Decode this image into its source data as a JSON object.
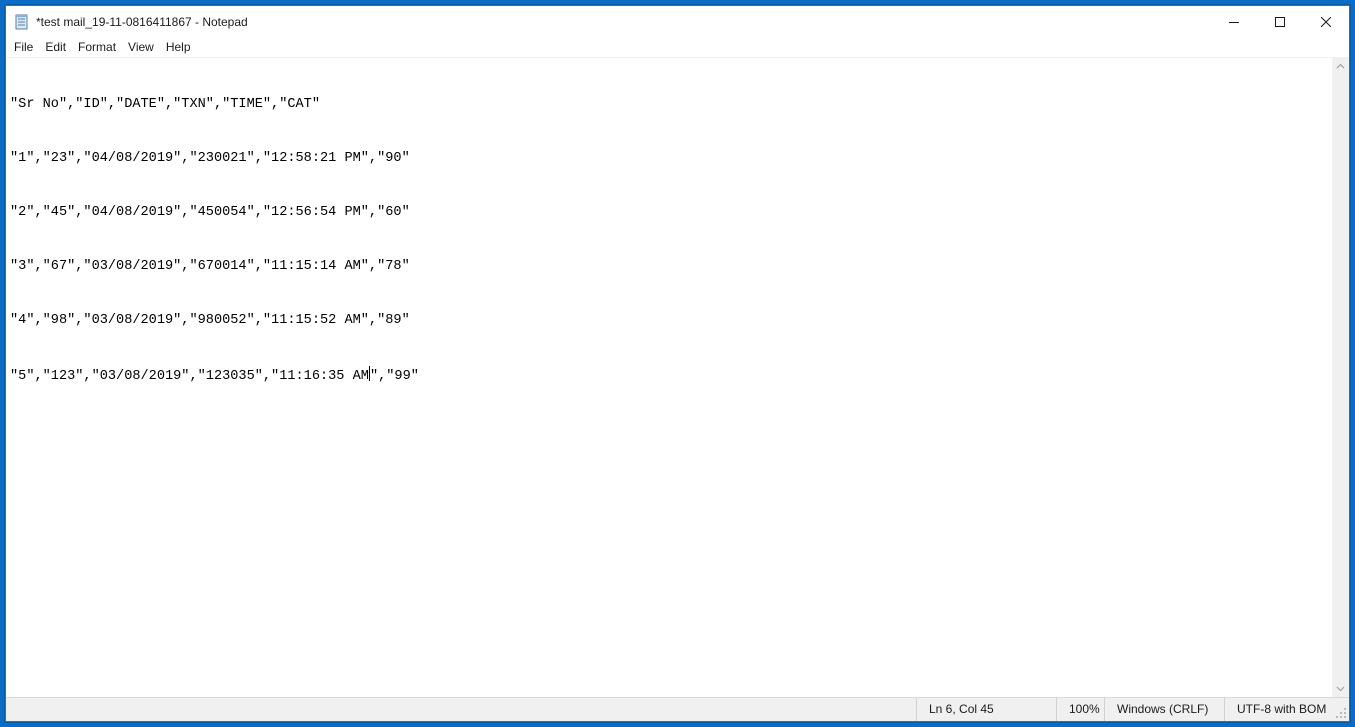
{
  "window": {
    "title": "*test mail_19-11-0816411867 - Notepad",
    "controls": {
      "minimize": "minimize-icon",
      "maximize": "maximize-icon",
      "close": "close-icon"
    }
  },
  "menu": [
    "File",
    "Edit",
    "Format",
    "View",
    "Help"
  ],
  "editor": {
    "lines": [
      "\"Sr No\",\"ID\",\"DATE\",\"TXN\",\"TIME\",\"CAT\"",
      "\"1\",\"23\",\"04/08/2019\",\"230021\",\"12:58:21 PM\",\"90\"",
      "\"2\",\"45\",\"04/08/2019\",\"450054\",\"12:56:54 PM\",\"60\"",
      "\"3\",\"67\",\"03/08/2019\",\"670014\",\"11:15:14 AM\",\"78\"",
      "\"4\",\"98\",\"03/08/2019\",\"980052\",\"11:15:52 AM\",\"89\""
    ],
    "last_line_before_caret": "\"5\",\"123\",\"03/08/2019\",\"123035\",\"11:16:35 AM",
    "last_line_after_caret": "\",\"99\""
  },
  "status": {
    "position": "Ln 6, Col 45",
    "zoom": "100%",
    "line_ending": "Windows (CRLF)",
    "encoding": "UTF-8 with BOM"
  },
  "colors": {
    "desktop": "#0a6cc4",
    "window_border": "#1a76c9",
    "statusbar": "#f0f0f0"
  }
}
